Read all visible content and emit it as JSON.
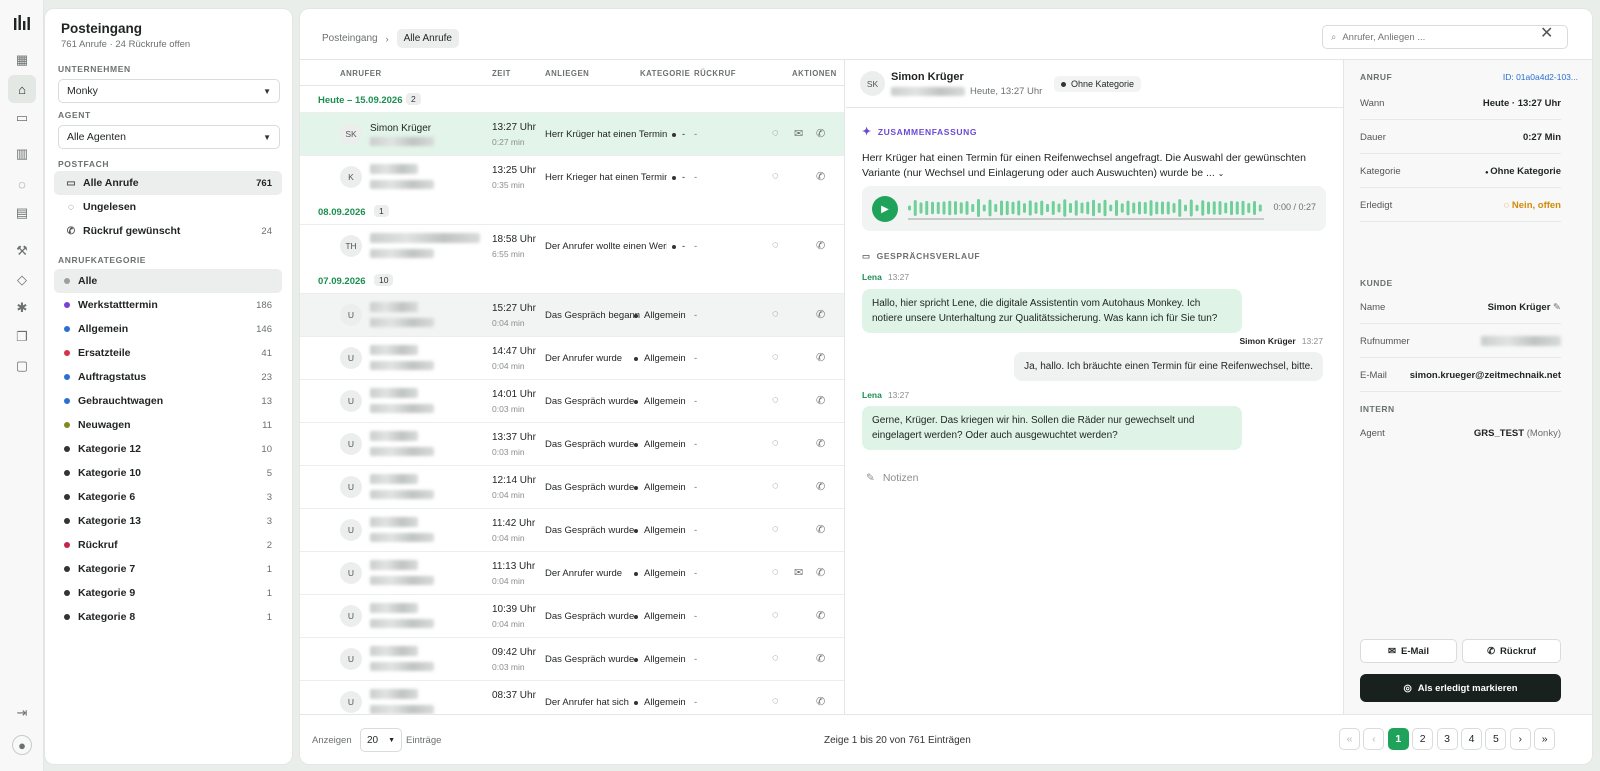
{
  "sidebar": {
    "title": "Posteingang",
    "subtitle": "761 Anrufe · 24 Rückrufe offen",
    "company_label": "UNTERNEHMEN",
    "company_value": "Monky",
    "agent_label": "AGENT",
    "agent_value": "Alle Agenten",
    "mailbox_label": "POSTFACH",
    "mailbox": [
      {
        "label": "Alle Anrufe",
        "count": "761",
        "icon": "inbox-icon"
      },
      {
        "label": "Ungelesen",
        "count": "",
        "icon": "unread-icon"
      },
      {
        "label": "Rückruf gewünscht",
        "count": "24",
        "icon": "callback-icon"
      }
    ],
    "category_label": "ANRUFKATEGORIE",
    "categories": [
      {
        "label": "Alle",
        "count": "",
        "color": "#9aa09d"
      },
      {
        "label": "Werkstatttermin",
        "count": "186",
        "color": "#7b3fd4"
      },
      {
        "label": "Allgemein",
        "count": "146",
        "color": "#2a6fd1"
      },
      {
        "label": "Ersatzteile",
        "count": "41",
        "color": "#d4334a"
      },
      {
        "label": "Auftragstatus",
        "count": "23",
        "color": "#2a6fd1"
      },
      {
        "label": "Gebrauchtwagen",
        "count": "13",
        "color": "#2a6fd1"
      },
      {
        "label": "Neuwagen",
        "count": "11",
        "color": "#7f8a1f"
      },
      {
        "label": "Kategorie 12",
        "count": "10",
        "color": "#333333"
      },
      {
        "label": "Kategorie 10",
        "count": "5",
        "color": "#333333"
      },
      {
        "label": "Kategorie 6",
        "count": "3",
        "color": "#333333"
      },
      {
        "label": "Kategorie 13",
        "count": "3",
        "color": "#333333"
      },
      {
        "label": "Rückruf",
        "count": "2",
        "color": "#c3264a"
      },
      {
        "label": "Kategorie 7",
        "count": "1",
        "color": "#333333"
      },
      {
        "label": "Kategorie 9",
        "count": "1",
        "color": "#333333"
      },
      {
        "label": "Kategorie 8",
        "count": "1",
        "color": "#333333"
      }
    ]
  },
  "header": {
    "breadcrumb_root": "Posteingang",
    "breadcrumb_current": "Alle Anrufe",
    "search_placeholder": "Anrufer, Anliegen ..."
  },
  "list": {
    "columns": {
      "caller": "ANRUFER",
      "time": "ZEIT",
      "concern": "ANLIEGEN",
      "category": "KATEGORIE",
      "callback": "RÜCKRUF",
      "actions": "AKTIONEN"
    },
    "groups": [
      {
        "label": "Heute – 15.09.2026",
        "count": "2",
        "rows": [
          {
            "initials": "SK",
            "name": "Simon Krüger",
            "time": "13:27 Uhr",
            "dur": "0:27 min",
            "concern": "Herr Krüger hat einen Termin für einen",
            "category": "-",
            "callback": "-",
            "mail": true,
            "selected": true
          },
          {
            "initials": "K",
            "name": "",
            "time": "13:25 Uhr",
            "dur": "0:35 min",
            "concern": "Herr Krieger hat einen Termin für",
            "category": "-",
            "callback": "-",
            "mail": false
          }
        ]
      },
      {
        "label": "08.09.2026",
        "count": "1",
        "rows": [
          {
            "initials": "TH",
            "name": "",
            "time": "18:58 Uhr",
            "dur": "6:55 min",
            "concern": "Der Anrufer wollte einen Werkstatttermin",
            "category": "-",
            "callback": "-",
            "mail": false
          }
        ]
      },
      {
        "label": "07.09.2026",
        "count": "10",
        "rows": [
          {
            "initials": "U",
            "name": "",
            "time": "15:27 Uhr",
            "dur": "0:04 min",
            "concern": "Das Gespräch begann",
            "category": "Allgemein",
            "callback": "-",
            "mail": false,
            "hover": true
          },
          {
            "initials": "U",
            "name": "",
            "time": "14:47 Uhr",
            "dur": "0:04 min",
            "concern": "Der Anrufer wurde",
            "category": "Allgemein",
            "callback": "-",
            "mail": false
          },
          {
            "initials": "U",
            "name": "",
            "time": "14:01 Uhr",
            "dur": "0:03 min",
            "concern": "Das Gespräch wurde",
            "category": "Allgemein",
            "callback": "-",
            "mail": false
          },
          {
            "initials": "U",
            "name": "",
            "time": "13:37 Uhr",
            "dur": "0:03 min",
            "concern": "Das Gespräch wurde",
            "category": "Allgemein",
            "callback": "-",
            "mail": false
          },
          {
            "initials": "U",
            "name": "",
            "time": "12:14 Uhr",
            "dur": "0:04 min",
            "concern": "Das Gespräch wurde",
            "category": "Allgemein",
            "callback": "-",
            "mail": false
          },
          {
            "initials": "U",
            "name": "",
            "time": "11:42 Uhr",
            "dur": "0:04 min",
            "concern": "Das Gespräch wurde",
            "category": "Allgemein",
            "callback": "-",
            "mail": false
          },
          {
            "initials": "U",
            "name": "",
            "time": "11:13 Uhr",
            "dur": "0:04 min",
            "concern": "Der Anrufer wurde",
            "category": "Allgemein",
            "callback": "-",
            "mail": true
          },
          {
            "initials": "U",
            "name": "",
            "time": "10:39 Uhr",
            "dur": "0:04 min",
            "concern": "Das Gespräch wurde",
            "category": "Allgemein",
            "callback": "-",
            "mail": false
          },
          {
            "initials": "U",
            "name": "",
            "time": "09:42 Uhr",
            "dur": "0:03 min",
            "concern": "Das Gespräch wurde",
            "category": "Allgemein",
            "callback": "-",
            "mail": false
          },
          {
            "initials": "U",
            "name": "",
            "time": "08:37 Uhr",
            "dur": "",
            "concern": "Der Anrufer hat sich",
            "category": "Allgemein",
            "callback": "-",
            "mail": false
          }
        ]
      }
    ]
  },
  "detail": {
    "initials": "SK",
    "name": "Simon Krüger",
    "when": "Heute, 13:27 Uhr",
    "badge": "Ohne Kategorie",
    "summary_label": "ZUSAMMENFASSUNG",
    "summary": "Herr Krüger hat einen Termin für einen Reifenwechsel angefragt. Die Auswahl der gewünschten Variante (nur Wechsel und Einlagerung oder auch Auswuchten) wurde be ...",
    "audio_time": "0:00 / 0:27",
    "audio_progress": 0,
    "transcript_label": "GESPRÄCHSVERLAUF",
    "messages": [
      {
        "who": "Lena",
        "ts": "13:27",
        "text": "Hallo, hier spricht Lene, die digitale Assistentin vom Autohaus Monkey. Ich notiere unsere Unterhaltung zur Qualitätssicherung. Was kann ich für Sie tun?",
        "agent": true
      },
      {
        "who": "Simon Krüger",
        "ts": "13:27",
        "text": "Ja, hallo. Ich bräuchte einen Termin für eine Reifenwechsel, bitte.",
        "agent": false
      },
      {
        "who": "Lena",
        "ts": "13:27",
        "text": "Gerne, Krüger. Das kriegen wir hin. Sollen die Räder nur gewechselt und eingelagert werden? Oder auch ausgewuchtet werden?",
        "agent": true
      }
    ],
    "notes_placeholder": "Notizen"
  },
  "info": {
    "call_label": "ANRUF",
    "id": "ID: 01a0a4d2-103...",
    "rows": [
      {
        "k": "Wann",
        "v": "Heute · 13:27 Uhr"
      },
      {
        "k": "Dauer",
        "v": "0:27 Min"
      },
      {
        "k": "Kategorie",
        "v": "Ohne Kategorie"
      },
      {
        "k": "Erledigt",
        "v": "Nein, offen"
      }
    ],
    "customer_label": "KUNDE",
    "customer_rows": [
      {
        "k": "Name",
        "v": "Simon Krüger"
      },
      {
        "k": "Rufnummer",
        "v": ""
      },
      {
        "k": "E-Mail",
        "v": "simon.krueger@zeitmechnaik.net"
      }
    ],
    "intern_label": "INTERN",
    "agent_k": "Agent",
    "agent_v": "GRS_TEST",
    "agent_sub": "(Monky)",
    "btn_email": "E-Mail",
    "btn_callback": "Rückruf",
    "btn_done": "Als erledigt markieren",
    "done_color": "#d48a0a",
    "accent": "#1fa35a"
  },
  "footer": {
    "show_label": "Anzeigen",
    "page_size": "20",
    "entries_label": "Einträge",
    "info": "Zeige 1 bis 20 von 761 Einträgen",
    "pages": [
      "1",
      "2",
      "3",
      "4",
      "5"
    ],
    "first": "«",
    "prev": "‹",
    "next": "›",
    "last": "»"
  }
}
